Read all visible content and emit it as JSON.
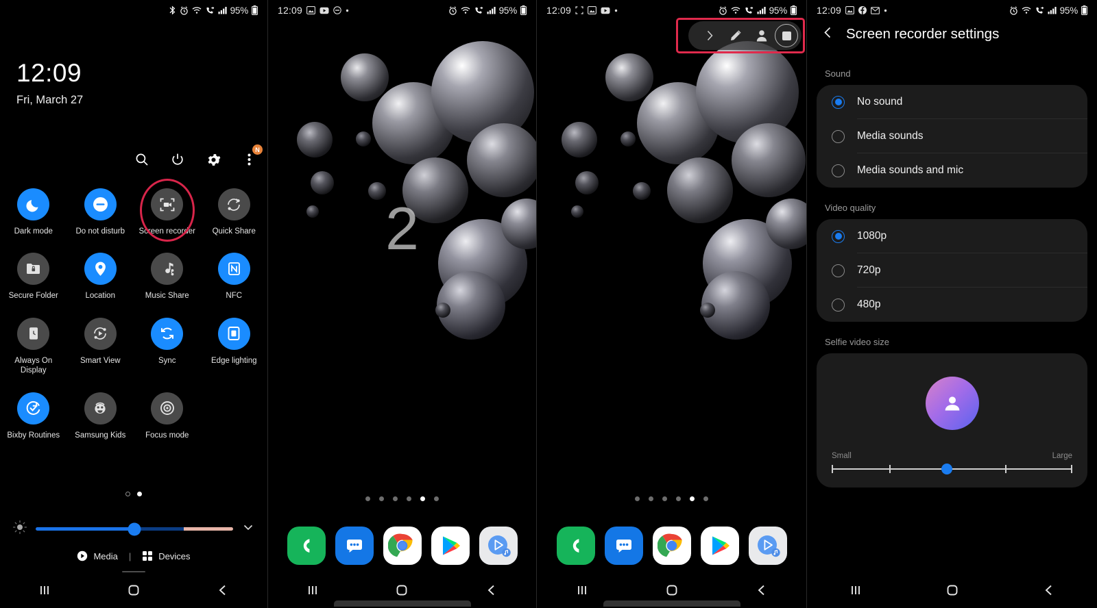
{
  "panel1": {
    "statusbar": {
      "icons": [
        "bluetooth-icon",
        "alarm-icon",
        "wifi-icon",
        "call-forwarding-icon",
        "signal-icon"
      ],
      "battery_text": "95%"
    },
    "clock": "12:09",
    "date": "Fri, March 27",
    "actions": [
      {
        "name": "search-icon",
        "label": "Search"
      },
      {
        "name": "power-icon",
        "label": "Power"
      },
      {
        "name": "settings-gear-icon",
        "label": "Settings"
      },
      {
        "name": "more-options-icon",
        "label": "More",
        "badge": "N"
      }
    ],
    "tiles": [
      {
        "label": "Dark mode",
        "icon": "moon-icon",
        "state": "on"
      },
      {
        "label": "Do not disturb",
        "icon": "do-not-disturb-icon",
        "state": "on"
      },
      {
        "label": "Screen recorder",
        "icon": "screen-recorder-icon",
        "state": "off",
        "highlighted": true
      },
      {
        "label": "Quick Share",
        "icon": "quick-share-icon",
        "state": "off"
      },
      {
        "label": "Secure Folder",
        "icon": "secure-folder-icon",
        "state": "off"
      },
      {
        "label": "Location",
        "icon": "location-pin-icon",
        "state": "on"
      },
      {
        "label": "Music Share",
        "icon": "music-share-icon",
        "state": "off"
      },
      {
        "label": "NFC",
        "icon": "nfc-icon",
        "state": "on"
      },
      {
        "label": "Always On Display",
        "icon": "always-on-display-icon",
        "state": "off"
      },
      {
        "label": "Smart View",
        "icon": "smart-view-icon",
        "state": "off"
      },
      {
        "label": "Sync",
        "icon": "sync-icon",
        "state": "on"
      },
      {
        "label": "Edge lighting",
        "icon": "edge-lighting-icon",
        "state": "on"
      },
      {
        "label": "Bixby Routines",
        "icon": "bixby-routines-icon",
        "state": "on"
      },
      {
        "label": "Samsung Kids",
        "icon": "samsung-kids-icon",
        "state": "off"
      },
      {
        "label": "Focus mode",
        "icon": "focus-mode-icon",
        "state": "off"
      }
    ],
    "brightness": {
      "value_percent": 51,
      "icon": "brightness-icon",
      "expand_icon": "chevron-down-icon"
    },
    "page_dots": {
      "count": 2,
      "active_index": 1
    },
    "footer": {
      "media_label": "Media",
      "devices_label": "Devices",
      "separator": "|"
    }
  },
  "panel2": {
    "statusbar": {
      "time": "12:09",
      "left_icons": [
        "image-icon",
        "youtube-icon",
        "do-not-disturb-icon",
        "dot-icon"
      ],
      "right_icons": [
        "alarm-icon",
        "wifi-icon",
        "call-forwarding-icon",
        "signal-icon"
      ],
      "battery_text": "95%"
    },
    "countdown": "2",
    "home_dots": {
      "count": 6,
      "active_index": 4
    },
    "dock_apps": [
      {
        "name": "phone-app-icon",
        "label": "Phone"
      },
      {
        "name": "messages-app-icon",
        "label": "Messages"
      },
      {
        "name": "chrome-app-icon",
        "label": "Chrome"
      },
      {
        "name": "play-store-app-icon",
        "label": "Play Store"
      },
      {
        "name": "play-music-app-icon",
        "label": "Play Music"
      }
    ]
  },
  "panel3": {
    "statusbar": {
      "time": "12:09",
      "left_icons": [
        "screen-recorder-icon",
        "image-icon",
        "youtube-icon",
        "dot-icon"
      ],
      "right_icons": [
        "alarm-icon",
        "wifi-icon",
        "call-forwarding-icon",
        "signal-icon"
      ],
      "battery_text": "95%"
    },
    "recorder_toolbar": {
      "buttons": [
        {
          "name": "expand-chevron-right-icon",
          "label": "Expand"
        },
        {
          "name": "pencil-draw-icon",
          "label": "Draw"
        },
        {
          "name": "selfie-person-icon",
          "label": "Selfie video"
        },
        {
          "name": "stop-recording-icon",
          "label": "Stop"
        }
      ],
      "highlighted": true
    },
    "home_dots": {
      "count": 6,
      "active_index": 4
    },
    "dock_apps": [
      {
        "name": "phone-app-icon",
        "label": "Phone"
      },
      {
        "name": "messages-app-icon",
        "label": "Messages"
      },
      {
        "name": "chrome-app-icon",
        "label": "Chrome"
      },
      {
        "name": "play-store-app-icon",
        "label": "Play Store"
      },
      {
        "name": "play-music-app-icon",
        "label": "Play Music"
      }
    ]
  },
  "panel4": {
    "statusbar": {
      "time": "12:09",
      "left_icons": [
        "image-icon",
        "facebook-icon",
        "gmail-icon",
        "dot-icon"
      ],
      "right_icons": [
        "alarm-icon",
        "wifi-icon",
        "call-forwarding-icon",
        "signal-icon"
      ],
      "battery_text": "95%"
    },
    "title": "Screen recorder settings",
    "back_icon": "back-chevron-icon",
    "sound": {
      "section_label": "Sound",
      "options": [
        {
          "label": "No sound",
          "selected": true
        },
        {
          "label": "Media sounds",
          "selected": false
        },
        {
          "label": "Media sounds and mic",
          "selected": false
        }
      ]
    },
    "video_quality": {
      "section_label": "Video quality",
      "options": [
        {
          "label": "1080p",
          "selected": true
        },
        {
          "label": "720p",
          "selected": false
        },
        {
          "label": "480p",
          "selected": false
        }
      ]
    },
    "selfie_video_size": {
      "section_label": "Selfie video size",
      "min_label": "Small",
      "max_label": "Large",
      "value_percent": 48,
      "avatar_icon": "person-avatar-icon"
    }
  },
  "navbar": {
    "recents_label": "Recents",
    "home_label": "Home",
    "back_label": "Back"
  },
  "colors": {
    "accent_blue": "#1a8cff",
    "highlight_red": "#d8254a",
    "tile_off": "#4a4a4a",
    "card_bg": "#1c1c1c"
  }
}
